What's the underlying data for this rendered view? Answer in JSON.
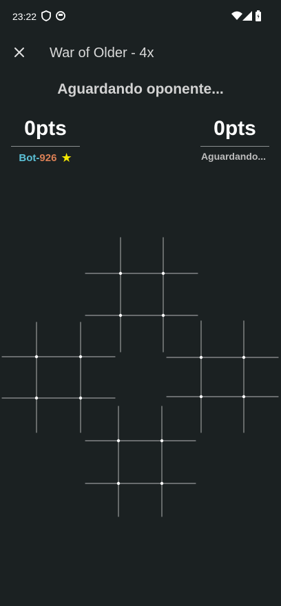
{
  "status_bar": {
    "time": "23:22",
    "icons": [
      "shield-icon",
      "sim-icon",
      "wifi-icon",
      "signal-icon",
      "battery-icon"
    ]
  },
  "app_bar": {
    "close_icon": "close-icon",
    "title": "War of Older - 4x"
  },
  "game": {
    "status_message": "Aguardando oponente...",
    "players": [
      {
        "score": "0pts",
        "name_part_a": "Bot",
        "name_sep": "-",
        "name_part_b": "926",
        "star": "★"
      },
      {
        "score": "0pts",
        "name": "Aguardando..."
      }
    ],
    "boards": [
      {
        "name": "board-red",
        "color": "#ff2a2a"
      },
      {
        "name": "board-blue",
        "color": "#1e90ff"
      },
      {
        "name": "board-orange",
        "color": "#ffae1a"
      },
      {
        "name": "board-green",
        "color": "#22dd44"
      }
    ]
  },
  "colors": {
    "background": "#1b2122",
    "accent_cyan": "#5bc0d6",
    "accent_orange": "#d97f55",
    "star": "#f5e800"
  }
}
